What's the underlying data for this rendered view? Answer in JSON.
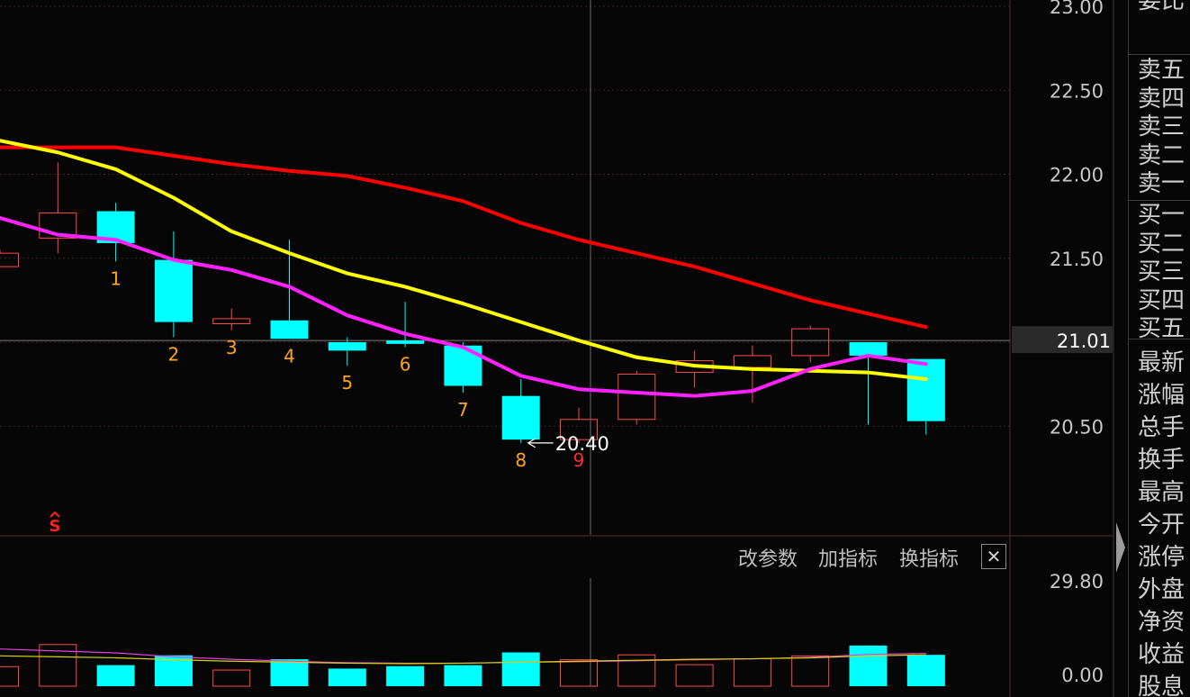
{
  "chart_data": {
    "type": "candlestick",
    "price_axis": {
      "ylim": [
        20.05,
        23.05
      ],
      "ticks": [
        "23.00",
        "22.50",
        "22.00",
        "21.50",
        "21.00",
        "20.50"
      ]
    },
    "current_price_label": "21.01",
    "current_price": 21.01,
    "candles": [
      {
        "open": 21.45,
        "close": 21.53,
        "high": 21.55,
        "low": 21.45,
        "color": "up"
      },
      {
        "open": 21.62,
        "close": 21.77,
        "high": 22.07,
        "low": 21.53,
        "color": "up"
      },
      {
        "open": 21.78,
        "close": 21.59,
        "high": 21.83,
        "low": 21.48,
        "color": "down"
      },
      {
        "open": 21.49,
        "close": 21.12,
        "high": 21.66,
        "low": 21.03,
        "color": "down"
      },
      {
        "open": 21.11,
        "close": 21.14,
        "high": 21.2,
        "low": 21.07,
        "color": "up"
      },
      {
        "open": 21.13,
        "close": 21.02,
        "high": 21.61,
        "low": 21.02,
        "color": "down"
      },
      {
        "open": 21.0,
        "close": 20.95,
        "high": 21.03,
        "low": 20.86,
        "color": "down"
      },
      {
        "open": 21.01,
        "close": 20.99,
        "high": 21.24,
        "low": 20.97,
        "color": "down"
      },
      {
        "open": 20.98,
        "close": 20.74,
        "high": 21.0,
        "low": 20.7,
        "color": "down"
      },
      {
        "open": 20.68,
        "close": 20.42,
        "high": 20.78,
        "low": 20.4,
        "color": "down"
      },
      {
        "open": 20.42,
        "close": 20.54,
        "high": 20.61,
        "low": 20.4,
        "color": "up"
      },
      {
        "open": 20.54,
        "close": 20.81,
        "high": 20.83,
        "low": 20.51,
        "color": "up"
      },
      {
        "open": 20.82,
        "close": 20.89,
        "high": 20.95,
        "low": 20.73,
        "color": "up"
      },
      {
        "open": 20.85,
        "close": 20.92,
        "high": 20.98,
        "low": 20.64,
        "color": "up"
      },
      {
        "open": 20.92,
        "close": 21.08,
        "high": 21.1,
        "low": 20.88,
        "color": "up"
      },
      {
        "open": 21.0,
        "close": 20.92,
        "high": 21.0,
        "low": 20.51,
        "color": "down"
      },
      {
        "open": 20.9,
        "close": 20.53,
        "high": 20.9,
        "low": 20.45,
        "color": "down"
      }
    ],
    "series": [
      {
        "color": "#ff0000",
        "values": [
          22.16,
          22.16,
          22.16,
          22.11,
          22.06,
          22.02,
          21.99,
          21.92,
          21.84,
          21.71,
          21.61,
          21.53,
          21.45,
          21.35,
          21.25,
          21.17,
          21.09
        ]
      },
      {
        "color": "#ffff00",
        "values": [
          22.2,
          22.13,
          22.03,
          21.86,
          21.66,
          21.53,
          21.41,
          21.33,
          21.23,
          21.12,
          21.01,
          20.91,
          20.86,
          20.84,
          20.83,
          20.82,
          20.78
        ]
      },
      {
        "color": "#ff22ff",
        "values": [
          21.74,
          21.64,
          21.61,
          21.49,
          21.43,
          21.33,
          21.16,
          21.05,
          20.97,
          20.8,
          20.72,
          20.7,
          20.68,
          20.71,
          20.84,
          20.92,
          20.87
        ]
      }
    ],
    "wave_labels": [
      {
        "text": "1",
        "candle": 2
      },
      {
        "text": "2",
        "candle": 3
      },
      {
        "text": "3",
        "candle": 4
      },
      {
        "text": "4",
        "candle": 5
      },
      {
        "text": "5",
        "candle": 6
      },
      {
        "text": "6",
        "candle": 7
      },
      {
        "text": "7",
        "candle": 8
      },
      {
        "text": "8",
        "candle": 9
      },
      {
        "text": "9",
        "candle": 10
      }
    ],
    "low_annotation": {
      "text": "20.40",
      "candle": 9,
      "price": 20.4
    },
    "signal_marker": {
      "text": "S"
    },
    "colors": {
      "up": "#ff4a4a",
      "down": "#00ffff",
      "label": "#ffa41c",
      "label_last": "#ff2a2a",
      "signal": "#ff2020"
    },
    "volume_axis": {
      "ylim": [
        0,
        29.8
      ],
      "ticks": [
        "29.80",
        "0.00"
      ]
    },
    "volume": [
      4.0,
      8.5,
      4.3,
      6.3,
      3.3,
      5.5,
      3.6,
      4.1,
      4.3,
      6.9,
      5.4,
      6.4,
      4.4,
      5.6,
      6.2,
      8.3,
      6.4
    ],
    "volume_ma": [
      {
        "color": "#e040e0",
        "values": [
          7.6,
          7.2,
          6.8,
          6.0,
          5.5,
          5.1,
          4.8,
          4.7,
          4.7,
          4.9,
          5.0,
          5.2,
          5.4,
          5.6,
          5.9,
          6.5,
          6.7
        ]
      },
      {
        "color": "#d4d400",
        "values": [
          6.2,
          6.0,
          5.8,
          5.4,
          5.1,
          4.9,
          4.7,
          4.6,
          4.7,
          4.9,
          5.1,
          5.3,
          5.5,
          5.6,
          5.8,
          6.2,
          6.4
        ]
      }
    ]
  },
  "toolbar": {
    "change_params": "改参数",
    "add_indicator": "加指标",
    "switch_indicator": "换指标",
    "close_symbol": "✕"
  },
  "side_panel": {
    "top_cut": "委比",
    "sell_levels": [
      "卖五",
      "卖四",
      "卖三",
      "卖二",
      "卖一"
    ],
    "buy_levels": [
      "买一",
      "买二",
      "买三",
      "买四",
      "买五"
    ],
    "stats": [
      "最新",
      "涨幅",
      "总手",
      "换手",
      "最高",
      "今开",
      "涨停",
      "外盘",
      "净资",
      "收益",
      "股息"
    ]
  }
}
